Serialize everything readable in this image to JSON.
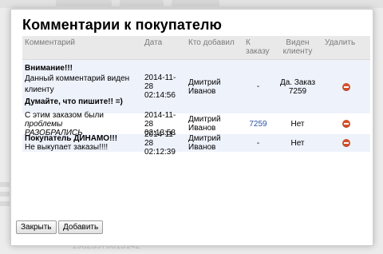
{
  "dialog": {
    "title": "Комментарии к покупателю"
  },
  "table": {
    "headers": {
      "comment": "Комментарий",
      "date": "Дата",
      "added_by": "Кто добавил",
      "order_line1": "К",
      "order_line2": "заказу",
      "seen_line1": "Виден",
      "seen_line2": "клиенту",
      "delete": "Удалить"
    },
    "rows": [
      {
        "comment_head": "Внимание!!!",
        "comment_body_1": "Данный комментарий виден",
        "comment_body_2": "клиенту",
        "comment_tail": "Думайте, что пишите!! =)",
        "date_1": "2014-11-28",
        "date_2": "02:14:56",
        "author_1": "Дмитрий",
        "author_2": "Иванов",
        "order": "-",
        "seen_1": "Да. Заказ",
        "seen_2": "7259"
      },
      {
        "comment_plain": "С этим заказом были ",
        "comment_italic_1": "проблемы",
        "comment_italic_2": "РАЗОБРАЛИСЬ",
        "date_1": "2014-11-28",
        "date_2": "02:13:58",
        "author_1": "Дмитрий",
        "author_2": "Иванов",
        "order": "7259",
        "seen": "Нет"
      },
      {
        "comment_head": "Покупатель ДИНАМО!!!",
        "comment_body": "Не выкупает заказы!!!!",
        "date_1": "2014-11-28",
        "date_2": "02:12:39",
        "author_1": "Дмитрий",
        "author_2": "Иванов",
        "order": "-",
        "seen": "Нет"
      }
    ]
  },
  "buttons": {
    "close": "Закрыть",
    "add": "Добавить"
  },
  "background": {
    "footer_text": "19823576013142"
  },
  "colors": {
    "delete_icon": "#d5502b",
    "link": "#2a55a8",
    "row_highlight": "#eef2fb"
  }
}
